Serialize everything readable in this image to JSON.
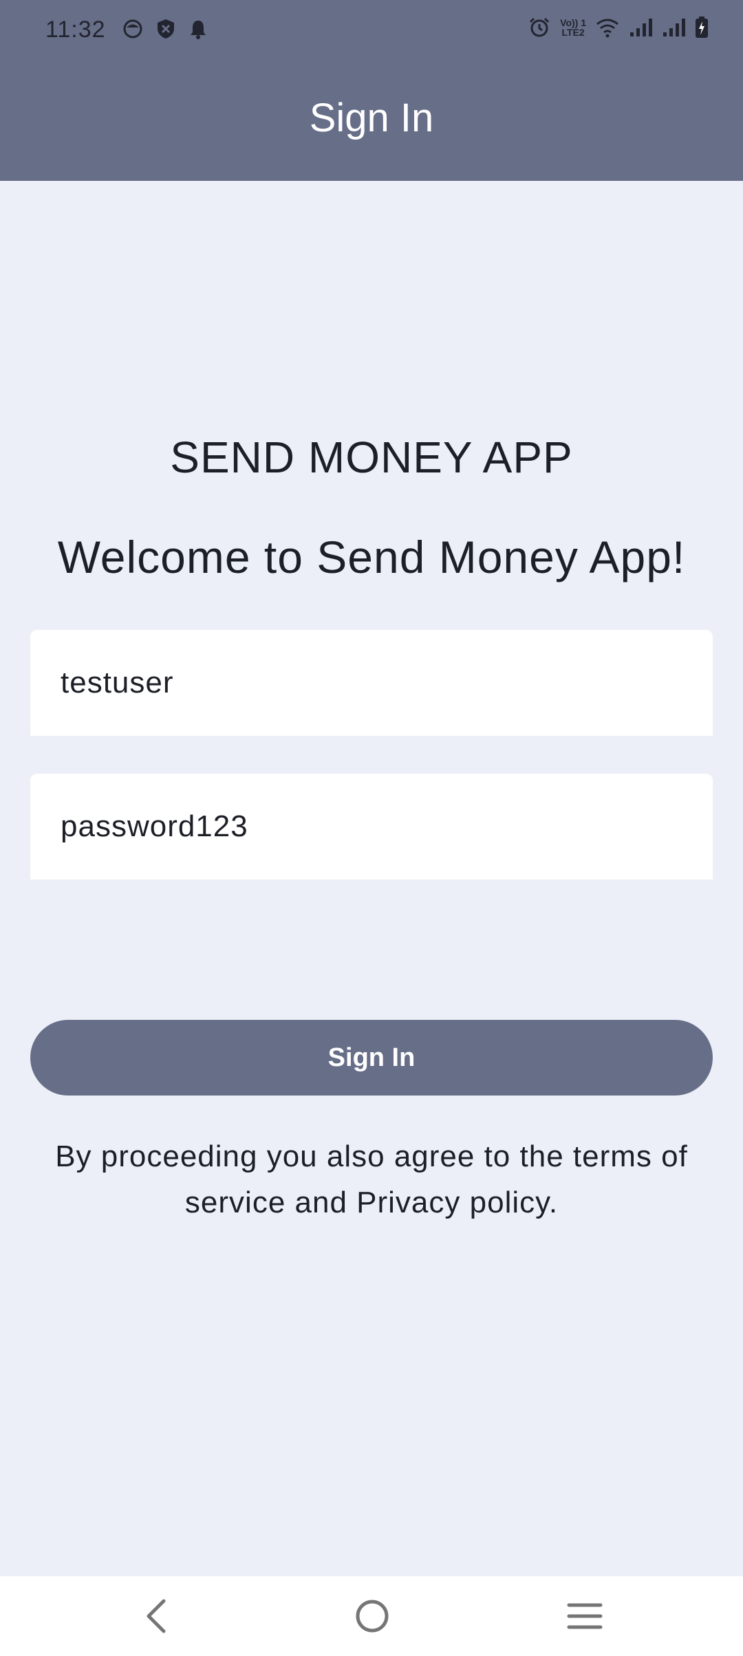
{
  "status_bar": {
    "time": "11:32",
    "left_icons": [
      "face-icon",
      "shield-x-icon",
      "bell-icon"
    ],
    "right_icons": [
      "alarm-icon",
      "volte-icon",
      "wifi-icon",
      "signal-icon",
      "signal-icon",
      "battery-charging-icon"
    ],
    "volte_line1": "Vo)) 1",
    "volte_line2": "LTE2"
  },
  "app_bar": {
    "title": "Sign In"
  },
  "main": {
    "app_name": "SEND MONEY APP",
    "welcome": "Welcome to Send Money App!",
    "username_value": "testuser",
    "password_value": "password123",
    "sign_in_label": "Sign In",
    "terms_text": "By proceeding you also agree to the terms of service and Privacy policy."
  },
  "nav_bar": {
    "icons": [
      "back-icon",
      "home-icon",
      "recents-menu-icon"
    ]
  },
  "colors": {
    "primary": "#676e88",
    "background": "#eceff8",
    "text": "#1d1f27"
  }
}
